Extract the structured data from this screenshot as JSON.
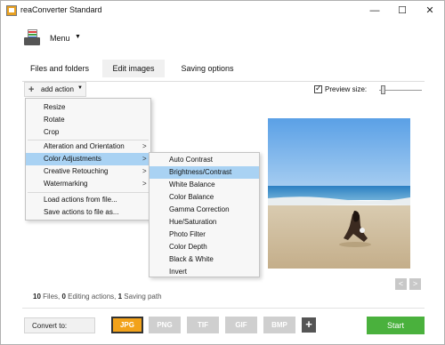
{
  "window": {
    "title": "reaConverter Standard",
    "minimize": "—",
    "maximize": "☐",
    "close": "✕"
  },
  "menu": {
    "label": "Menu",
    "caret": "▼"
  },
  "tabs": [
    {
      "label": "Files and folders"
    },
    {
      "label": "Edit images"
    },
    {
      "label": "Saving options"
    }
  ],
  "toolbar": {
    "add_action_icon": "+",
    "add_action_label": "add action",
    "add_action_caret": "▼",
    "preview_label": "Preview size:",
    "preview_checked": true
  },
  "dropdown": {
    "items": [
      {
        "label": "Resize"
      },
      {
        "label": "Rotate"
      },
      {
        "label": "Crop"
      },
      {
        "label": "Alteration and Orientation",
        "arrow": ">"
      },
      {
        "label": "Color Adjustments",
        "arrow": ">"
      },
      {
        "label": "Creative Retouching",
        "arrow": ">"
      },
      {
        "label": "Watermarking",
        "arrow": ">"
      },
      {
        "label": "Load actions from file..."
      },
      {
        "label": "Save actions to file as..."
      }
    ]
  },
  "submenu": {
    "items": [
      {
        "label": "Auto Contrast"
      },
      {
        "label": "Brightness/Contrast"
      },
      {
        "label": "White Balance"
      },
      {
        "label": "Color Balance"
      },
      {
        "label": "Gamma Correction"
      },
      {
        "label": "Hue/Saturation"
      },
      {
        "label": "Photo Filter"
      },
      {
        "label": "Color Depth"
      },
      {
        "label": "Black & White"
      },
      {
        "label": "Invert"
      }
    ]
  },
  "summary": {
    "files_count": "10",
    "files_label": " Files, ",
    "actions_count": "0",
    "actions_label": " Editing actions, ",
    "paths_count": "1",
    "paths_label": " Saving path"
  },
  "nav": {
    "prev": "<",
    "next": ">"
  },
  "bottom": {
    "convert_label": "Convert to:",
    "formats": [
      {
        "label": "JPG",
        "selected": true
      },
      {
        "label": "PNG"
      },
      {
        "label": "TIF"
      },
      {
        "label": "GIF"
      },
      {
        "label": "BMP"
      }
    ],
    "add_format": "+",
    "start_label": "Start"
  },
  "colors": {
    "start_green": "#4ab13d",
    "jpg_orange": "#f2a21a",
    "menu_highlight": "#a9d2f3",
    "format_grey": "#cfcfcf"
  }
}
